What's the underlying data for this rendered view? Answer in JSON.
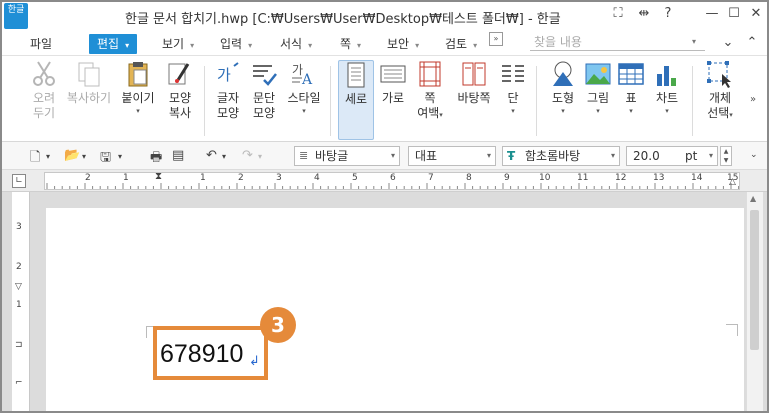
{
  "app": {
    "logo_text": "한글",
    "title": "한글 문서 합치기.hwp [C:₩Users₩User₩Desktop₩테스트 폴더₩] - 한글"
  },
  "menu": {
    "file": "파일",
    "edit": "편집",
    "view": "보기",
    "input": "입력",
    "format": "서식",
    "page": "쪽",
    "security": "보안",
    "review": "검토",
    "more": "»",
    "search_placeholder": "찾을 내용"
  },
  "ribbon": {
    "cut": [
      "오려",
      "두기"
    ],
    "copy": "복사하기",
    "paste": "붙이기",
    "format_copy": [
      "모양",
      "복사"
    ],
    "char_shape": [
      "글자",
      "모양"
    ],
    "para_shape": [
      "문단",
      "모양"
    ],
    "style": "스타일",
    "portrait": "세로",
    "landscape": "가로",
    "page_margin": [
      "쪽",
      "여백"
    ],
    "background": "바탕쪽",
    "columns": "단",
    "shape": "도형",
    "picture": "그림",
    "table": "표",
    "chart": "차트",
    "object_select": [
      "개체",
      "선택"
    ]
  },
  "toolbar": {
    "style_value": "바탕글",
    "lang_value": "대표",
    "font_value": "함초롬바탕",
    "size_value": "20.0",
    "size_unit": "pt"
  },
  "ruler": {
    "labels": [
      "2",
      "1",
      "1",
      "2",
      "3",
      "4",
      "5",
      "6",
      "7",
      "8",
      "9",
      "10",
      "11",
      "12",
      "13",
      "14",
      "15"
    ],
    "vertical_labels": [
      "3",
      "2",
      "1"
    ]
  },
  "document": {
    "text": "678910",
    "step_badge": "3"
  },
  "colors": {
    "accent": "#1f8fd6",
    "highlight": "#e58a3a"
  }
}
